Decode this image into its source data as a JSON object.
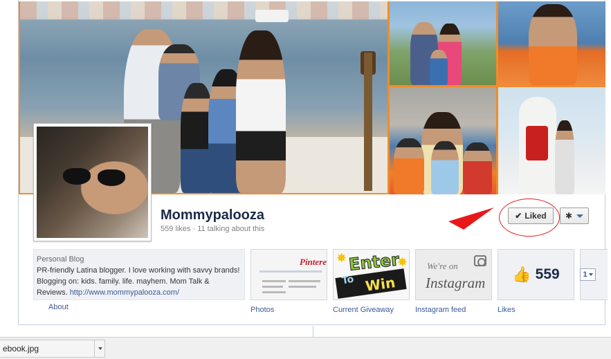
{
  "page": {
    "name": "Mommypalooza",
    "stats": "559 likes · 11 talking about this"
  },
  "actions": {
    "liked_label": "Liked"
  },
  "about": {
    "category": "Personal Blog",
    "description": "PR-friendly Latina blogger. I love working with savvy brands! Blogging on: kids. family. life. mayhem. Mom Talk & Reviews.",
    "link": "http://www.mommypalooza.com/",
    "label": "About"
  },
  "apps": [
    {
      "label": "Photos",
      "thumb_text": "Pinterest"
    },
    {
      "label": "Current Giveaway",
      "thumb_text_1": "Enter",
      "thumb_text_2": "To",
      "thumb_text_3": "Win"
    },
    {
      "label": "Instagram feed",
      "thumb_text_1": "We're on",
      "thumb_text_2": "Instagram"
    },
    {
      "label": "Likes",
      "count": "559"
    }
  ],
  "more": {
    "label": "1"
  },
  "download_bar": {
    "filename": "ebook.jpg"
  },
  "colors": {
    "cover_border": "#f08c2a",
    "link": "#3b5998",
    "annotation": "#e02020"
  }
}
